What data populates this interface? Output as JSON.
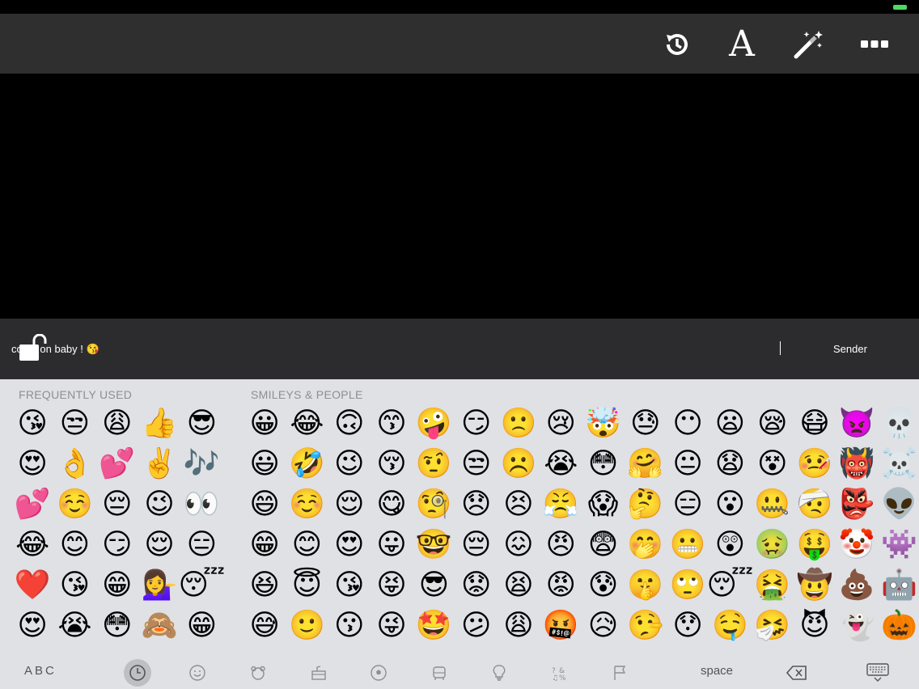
{
  "toolbar": {
    "icons": [
      "history-icon",
      "font-icon",
      "magic-wand-icon",
      "more-icon"
    ],
    "font_label": "A"
  },
  "message": {
    "text": "come on baby ! 😘",
    "sender_label": "Sender"
  },
  "keyboard": {
    "frequently_used": {
      "title": "FREQUENTLY USED",
      "columns": [
        [
          "😘",
          "😍",
          "💕",
          "😂",
          "❤️",
          "😍"
        ],
        [
          "😒",
          "👌",
          "☺️",
          "😊",
          "😘",
          "😭"
        ],
        [
          "😩",
          "💕",
          "😔",
          "😏",
          "😁",
          "😳"
        ],
        [
          "👍",
          "✌️",
          "😉",
          "😌",
          "💁‍♀️",
          "🙈"
        ],
        [
          "😎",
          "🎶",
          "👀",
          "😑",
          "😴",
          "😁"
        ]
      ]
    },
    "smileys_people": {
      "title": "SMILEYS & PEOPLE",
      "columns": [
        [
          "😀",
          "😃",
          "😄",
          "😁",
          "😆",
          "😅"
        ],
        [
          "😂",
          "🤣",
          "☺️",
          "😊",
          "😇",
          "🙂"
        ],
        [
          "🙃",
          "😉",
          "😌",
          "😍",
          "😘",
          "😗"
        ],
        [
          "😙",
          "😚",
          "😋",
          "😛",
          "😝",
          "😜"
        ],
        [
          "🤪",
          "🤨",
          "🧐",
          "🤓",
          "😎",
          "🤩"
        ],
        [
          "😏",
          "😒",
          "😞",
          "😔",
          "😟",
          "😕"
        ],
        [
          "🙁",
          "☹️",
          "😣",
          "😖",
          "😫",
          "😩"
        ],
        [
          "😢",
          "😭",
          "😤",
          "😠",
          "😡",
          "🤬"
        ],
        [
          "🤯",
          "😳",
          "😱",
          "😨",
          "😰",
          "😥"
        ],
        [
          "😓",
          "🤗",
          "🤔",
          "🤭",
          "🤫",
          "🤥"
        ],
        [
          "😶",
          "😐",
          "😑",
          "😬",
          "🙄",
          "😯"
        ],
        [
          "😦",
          "😧",
          "😮",
          "😲",
          "😴",
          "🤤"
        ],
        [
          "😪",
          "😵",
          "🤐",
          "🤢",
          "🤮",
          "🤧"
        ],
        [
          "😷",
          "🤒",
          "🤕",
          "🤑",
          "🤠",
          "😈"
        ],
        [
          "👿",
          "👹",
          "👺",
          "🤡",
          "💩",
          "👻"
        ],
        [
          "💀",
          "☠️",
          "👽",
          "👾",
          "🤖",
          "🎃"
        ]
      ]
    },
    "bottom": {
      "abc_label": "ABC",
      "space_label": "space",
      "categories": [
        "recent-icon",
        "smiley-icon",
        "animal-icon",
        "food-icon",
        "activity-icon",
        "travel-icon",
        "objects-icon",
        "symbols-icon",
        "flag-icon"
      ]
    }
  },
  "colors": {
    "toolbar_bg": "#2f2f2f",
    "message_bar_bg": "#2c2c2e",
    "keyboard_bg": "#dfe1e5",
    "battery": "#4cd964"
  }
}
